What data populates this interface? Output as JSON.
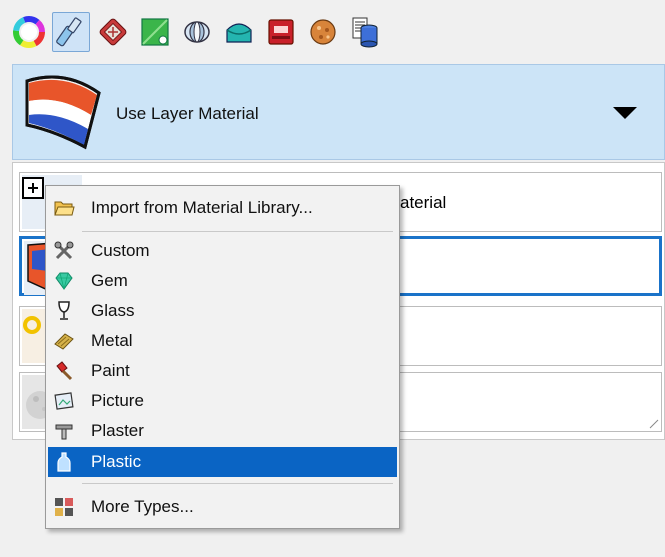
{
  "toolbar": {
    "buttons": [
      {
        "name": "color-wheel-icon",
        "active": false
      },
      {
        "name": "material-editor-icon",
        "active": true
      },
      {
        "name": "environment-icon",
        "active": false
      },
      {
        "name": "texture-icon",
        "active": false
      },
      {
        "name": "sun-icon",
        "active": false
      },
      {
        "name": "ground-plane-icon",
        "active": false
      },
      {
        "name": "render-settings-icon",
        "active": false
      },
      {
        "name": "decal-icon",
        "active": false
      },
      {
        "name": "library-icon",
        "active": false
      }
    ]
  },
  "header": {
    "title": "Use Layer Material",
    "icon": "layer-material-swatch"
  },
  "list": {
    "rows": [
      {
        "label": "aterial"
      },
      {
        "label": ""
      },
      {
        "label": ""
      },
      {
        "label": ""
      }
    ]
  },
  "menu": {
    "import": "Import from Material Library...",
    "items": [
      {
        "label": "Custom",
        "icon": "custom-icon"
      },
      {
        "label": "Gem",
        "icon": "gem-icon"
      },
      {
        "label": "Glass",
        "icon": "glass-icon"
      },
      {
        "label": "Metal",
        "icon": "metal-icon"
      },
      {
        "label": "Paint",
        "icon": "paint-icon"
      },
      {
        "label": "Picture",
        "icon": "picture-icon"
      },
      {
        "label": "Plaster",
        "icon": "plaster-icon"
      },
      {
        "label": "Plastic",
        "icon": "plastic-icon"
      }
    ],
    "more": "More Types...",
    "highlighted": "Plastic"
  },
  "colors": {
    "highlight": "#0a64c4",
    "header_bg": "#cce4f7",
    "selected_border": "#1a73c9"
  }
}
